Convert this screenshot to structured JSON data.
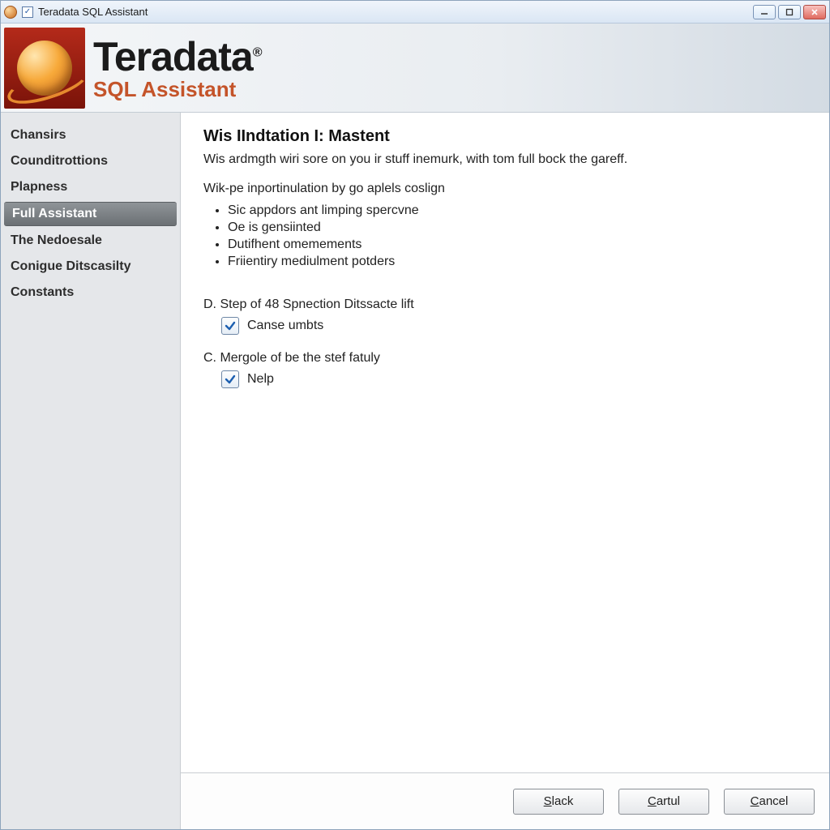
{
  "window": {
    "title": "Teradata SQL Assistant"
  },
  "brand": {
    "name": "Teradata",
    "registered": "®",
    "product": "SQL Assistant"
  },
  "sidebar": {
    "items": [
      {
        "label": "Chansirs",
        "selected": false
      },
      {
        "label": "Counditrottions",
        "selected": false
      },
      {
        "label": "Plapness",
        "selected": false
      },
      {
        "label": "Full Assistant",
        "selected": true
      },
      {
        "label": "The Nedoesale",
        "selected": false
      },
      {
        "label": "Conigue Ditscasilty",
        "selected": false
      },
      {
        "label": "Constants",
        "selected": false
      }
    ]
  },
  "page": {
    "heading": "Wis IIndtation I: Mastent",
    "intro": "Wis ardmgth wiri sore on you ir stuff inemurk, with tom full bock the gareff.",
    "subhead": "Wik-pe inportinulation by go aplels coslign",
    "bullets": [
      "Sic appdors ant limping spercvne",
      "Oe is gensiinted",
      "Dutifhent omemements",
      "Friientiry mediulment potders"
    ],
    "option_d": {
      "label": "D. Step of 48 Spnection Ditssacte lift",
      "checkbox_label": "Canse umbts",
      "checked": true
    },
    "option_c": {
      "label": "C. Mergole of be the stef fatuly",
      "checkbox_label": "Nelp",
      "checked": true
    }
  },
  "footer": {
    "back_char": "S",
    "back_rest": "lack",
    "next_char": "C",
    "next_rest": "artul",
    "cancel_char": "C",
    "cancel_rest": "ancel"
  }
}
